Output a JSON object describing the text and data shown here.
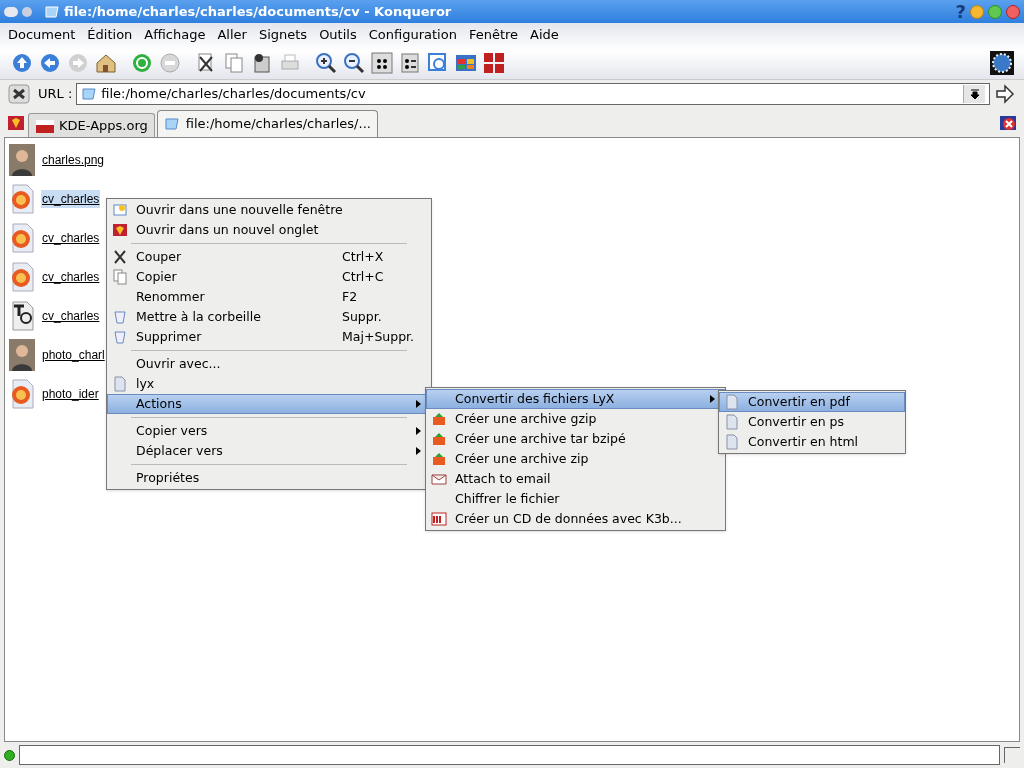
{
  "window": {
    "title": "file:/home/charles/charles/documents/cv - Konqueror",
    "help": "?"
  },
  "menubar": [
    "Document",
    "Édition",
    "Affichage",
    "Aller",
    "Signets",
    "Outils",
    "Configuration",
    "Fenêtre",
    "Aide"
  ],
  "location": {
    "label": "URL :",
    "value": "file:/home/charles/charles/documents/cv"
  },
  "tabs": [
    {
      "label": "KDE-Apps.org",
      "selected": false
    },
    {
      "label": "file:/home/charles/charles/...",
      "selected": true
    }
  ],
  "files": [
    {
      "name": "charles.png",
      "kind": "photo",
      "selected": false
    },
    {
      "name": "cv_charles",
      "kind": "lyx",
      "selected": true
    },
    {
      "name": "cv_charles",
      "kind": "lyx",
      "selected": false
    },
    {
      "name": "cv_charles",
      "kind": "lyx",
      "selected": false
    },
    {
      "name": "cv_charles",
      "kind": "tex",
      "selected": false
    },
    {
      "name": "photo_charl",
      "kind": "photo",
      "selected": false
    },
    {
      "name": "photo_ider",
      "kind": "lyx",
      "selected": false
    }
  ],
  "context_menu": [
    {
      "kind": "item",
      "label": "Ouvrir dans une nouvelle fenêtre",
      "selected": false
    },
    {
      "kind": "item",
      "label": "Ouvrir dans un nouvel onglet",
      "selected": false
    },
    {
      "kind": "separator"
    },
    {
      "kind": "item",
      "label": "Couper",
      "shortcut": "Ctrl+X",
      "selected": false
    },
    {
      "kind": "item",
      "label": "Copier",
      "shortcut": "Ctrl+C",
      "selected": false
    },
    {
      "kind": "item",
      "label": "Renommer",
      "shortcut": "F2",
      "selected": false
    },
    {
      "kind": "item",
      "label": "Mettre à la corbeille",
      "shortcut": "Suppr.",
      "selected": false
    },
    {
      "kind": "item",
      "label": "Supprimer",
      "shortcut": "Maj+Suppr.",
      "selected": false
    },
    {
      "kind": "separator"
    },
    {
      "kind": "item",
      "label": "Ouvrir avec...",
      "selected": false
    },
    {
      "kind": "item",
      "label": "lyx",
      "selected": false
    },
    {
      "kind": "item",
      "label": "Actions",
      "submenu": true,
      "selected": true
    },
    {
      "kind": "separator"
    },
    {
      "kind": "item",
      "label": "Copier vers",
      "submenu": true,
      "selected": false
    },
    {
      "kind": "item",
      "label": "Déplacer vers",
      "submenu": true,
      "selected": false
    },
    {
      "kind": "separator"
    },
    {
      "kind": "item",
      "label": "Propriétes",
      "selected": false
    }
  ],
  "actions_menu": [
    {
      "kind": "item",
      "label": "Convertir des fichiers LyX",
      "submenu": true,
      "selected": true
    },
    {
      "kind": "item",
      "label": "Créer une archive gzip",
      "selected": false
    },
    {
      "kind": "item",
      "label": "Créer une archive tar bzipé",
      "selected": false
    },
    {
      "kind": "item",
      "label": "Créer une archive zip",
      "selected": false
    },
    {
      "kind": "item",
      "label": "Attach to email",
      "selected": false
    },
    {
      "kind": "item",
      "label": "Chiffrer le fichier",
      "selected": false
    },
    {
      "kind": "item",
      "label": "Créer un CD de données avec K3b...",
      "selected": false
    }
  ],
  "convert_menu": [
    {
      "kind": "item",
      "label": "Convertir en pdf",
      "selected": true
    },
    {
      "kind": "item",
      "label": "Convertir en ps",
      "selected": false
    },
    {
      "kind": "item",
      "label": "Convertir en html",
      "selected": false
    }
  ]
}
